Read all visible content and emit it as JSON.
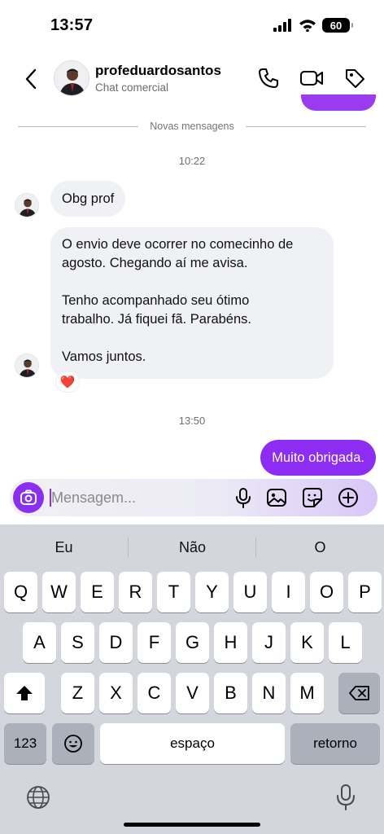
{
  "status_bar": {
    "time": "13:57",
    "battery": "60"
  },
  "header": {
    "name": "profeduardosantos",
    "subtitle": "Chat comercial"
  },
  "chat": {
    "divider_label": "Novas mensagens",
    "timestamp_1": "10:22",
    "msg_1": "Obg prof",
    "msg_2_lines": [
      "O envio deve ocorrer no comecinho de",
      "agosto. Chegando aí me avisa.",
      "",
      "Tenho acompanhado seu ótimo",
      "trabalho. Já fiquei fã. Parabéns.",
      "",
      "Vamos juntos."
    ],
    "reaction": "❤️",
    "timestamp_2": "13:50",
    "msg_3": "Muito obrigada."
  },
  "composer": {
    "placeholder": "Mensagem..."
  },
  "keyboard": {
    "suggestions": [
      "Eu",
      "Não",
      "O"
    ],
    "row1": [
      "Q",
      "W",
      "E",
      "R",
      "T",
      "Y",
      "U",
      "I",
      "O",
      "P"
    ],
    "row2": [
      "A",
      "S",
      "D",
      "F",
      "G",
      "H",
      "J",
      "K",
      "L"
    ],
    "row3": [
      "Z",
      "X",
      "C",
      "V",
      "B",
      "N",
      "M"
    ],
    "numbers_key": "123",
    "space_key": "espaço",
    "return_key": "retorno"
  },
  "colors": {
    "accent": "#8d2cf2",
    "incoming_bubble": "#f0f1f5",
    "keyboard_bg": "#d3d6dd"
  }
}
